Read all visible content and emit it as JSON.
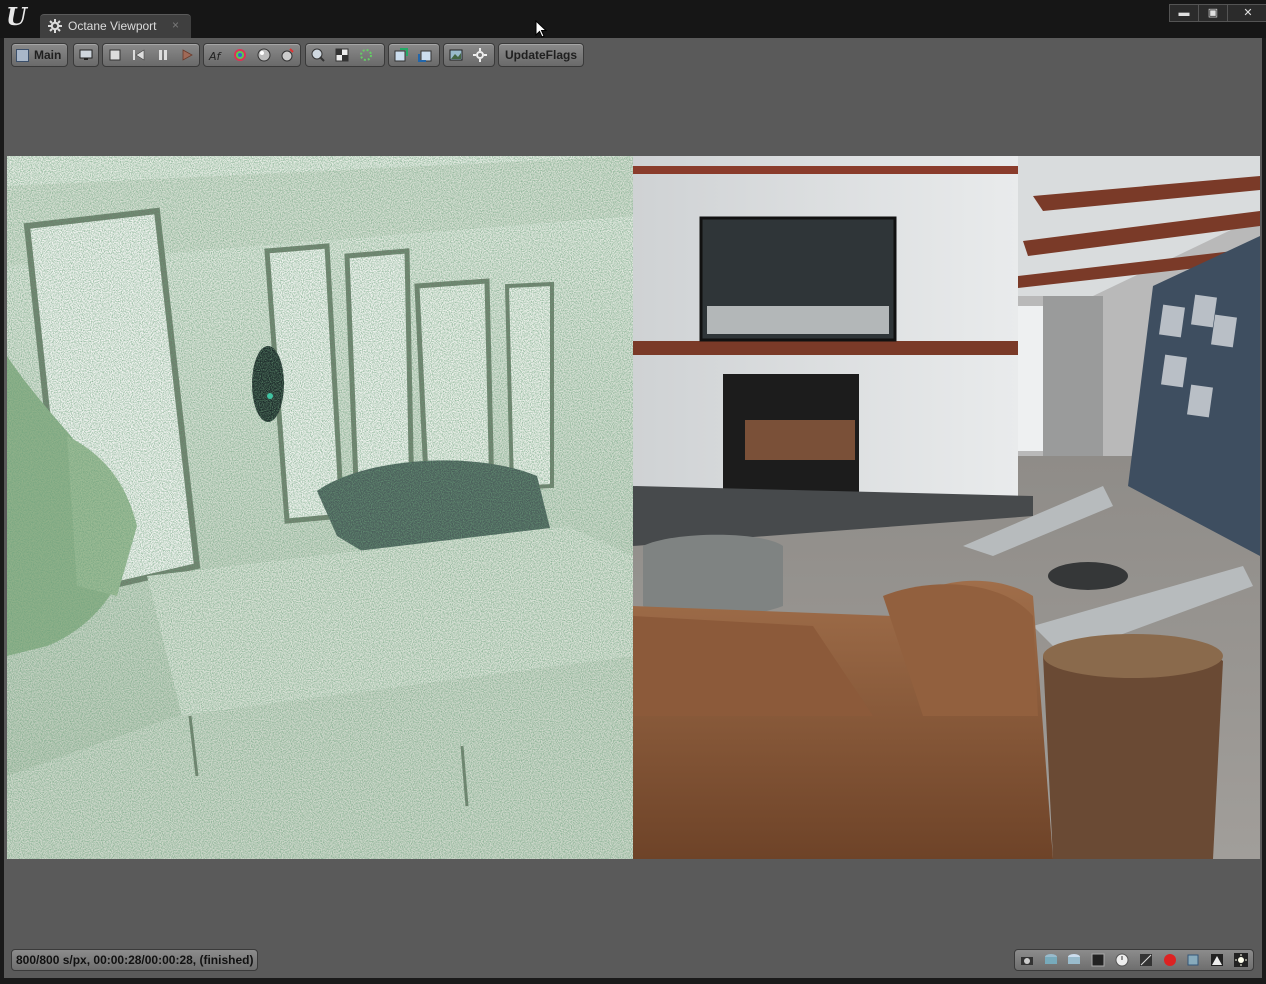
{
  "window": {
    "app_logo": "U",
    "tab": {
      "title": "Octane Viewport",
      "icon": "octane-gear-icon",
      "close_glyph": "×"
    },
    "controls": {
      "minimize": "▬",
      "maximize": "▣",
      "close": "✕"
    }
  },
  "toolbar": {
    "main_label": "Main",
    "update_flags_label": "UpdateFlags",
    "icons": [
      "display-icon",
      "stop-icon",
      "restart-icon",
      "pause-icon",
      "play-icon",
      "af-icon",
      "color-icon",
      "material-icon",
      "light-icon",
      "zoom-icon",
      "region-icon",
      "spinner-icon",
      "export-icon",
      "import-icon",
      "image-icon",
      "settings-gear-icon"
    ]
  },
  "status": {
    "text": "800/800 s/px, 00:00:28/00:00:28, (finished)"
  },
  "status_icons": [
    "camera-icon",
    "disk-icon",
    "disk-save-icon",
    "film-icon",
    "clock-icon",
    "grid-icon",
    "red-sphere-icon",
    "blue-cube-icon",
    "levels-icon",
    "sun-icon"
  ],
  "colors": {
    "panel_bg": "#5a5a5a",
    "titlebar_bg": "#161616",
    "leather": "#8a5a3a",
    "noise_green": "#c9d6c6"
  }
}
